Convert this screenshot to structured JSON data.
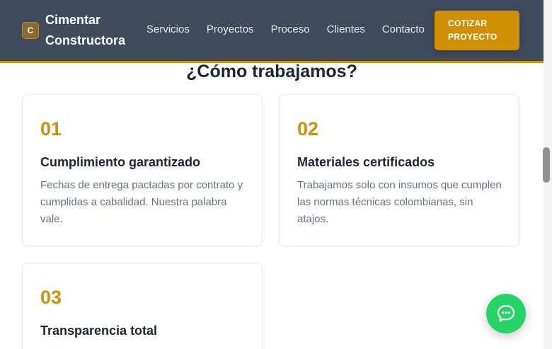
{
  "brand": {
    "logo_letter": "C",
    "name_line1": "Cimentar",
    "name_line2": "Constructora"
  },
  "nav": {
    "items": [
      "Servicios",
      "Proyectos",
      "Proceso",
      "Clientes",
      "Contacto"
    ]
  },
  "cta": {
    "line1": "COTIZAR",
    "line2": "PROYECTO"
  },
  "section": {
    "title": "¿Cómo trabajamos?"
  },
  "steps": [
    {
      "number": "01",
      "title": "Cumplimiento garantizado",
      "description": "Fechas de entrega pactadas por contrato y cumplidas a cabalidad. Nuestra palabra vale."
    },
    {
      "number": "02",
      "title": "Materiales certificados",
      "description": "Trabajamos solo con insumos que cumplen las normas técnicas colombianas, sin atajos."
    },
    {
      "number": "03",
      "title": "Transparencia total"
    }
  ],
  "chat": {
    "icon": "chat-bubble-icon"
  },
  "colors": {
    "navbar": "#3f4a5c",
    "accent": "#c9920f",
    "cta": "#cf9006",
    "chat": "#25d366"
  }
}
